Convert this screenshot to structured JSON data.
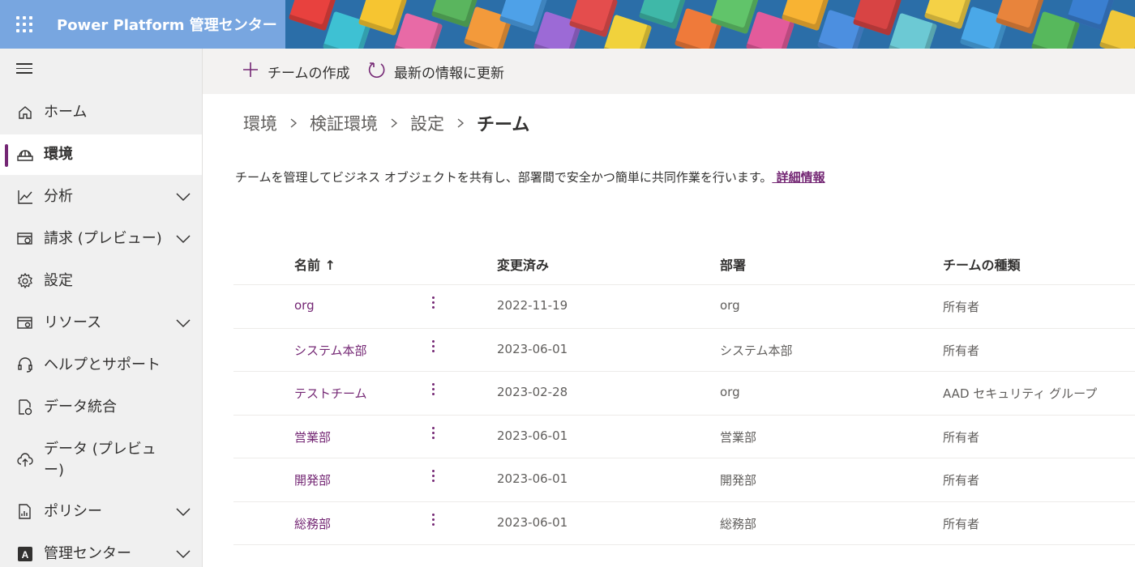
{
  "header": {
    "app_title": "Power Platform 管理センター",
    "accent": "#78a6e0"
  },
  "sidebar": {
    "items": [
      {
        "label": "ホーム",
        "icon": "home-icon"
      },
      {
        "label": "環境",
        "icon": "globe-icon",
        "selected": true
      },
      {
        "label": "分析",
        "icon": "chart-icon",
        "expandable": true
      },
      {
        "label": "請求 (プレビュー)",
        "icon": "billing-icon",
        "expandable": true
      },
      {
        "label": "設定",
        "icon": "gear-icon"
      },
      {
        "label": "リソース",
        "icon": "resources-icon",
        "expandable": true
      },
      {
        "label": "ヘルプとサポート",
        "icon": "headset-icon"
      },
      {
        "label": "データ統合",
        "icon": "data-integration-icon"
      },
      {
        "label": "データ (プレビュー)",
        "icon": "cloud-upload-icon"
      },
      {
        "label": "ポリシー",
        "icon": "policy-icon",
        "expandable": true
      },
      {
        "label": "管理センター",
        "icon": "admin-center-icon",
        "expandable": true
      }
    ]
  },
  "toolbar": {
    "create_team_label": "チームの作成",
    "refresh_label": "最新の情報に更新"
  },
  "breadcrumb": {
    "items": [
      "環境",
      "検証環境",
      "設定"
    ],
    "current": "チーム"
  },
  "description": {
    "text": "チームを管理してビジネス オブジェクトを共有し、部署間で安全かつ簡単に共同作業を行います。",
    "link": " 詳細情報"
  },
  "table": {
    "columns": {
      "name": "名前 ↑",
      "modified": "変更済み",
      "department": "部署",
      "team_type": "チームの種類"
    },
    "rows": [
      {
        "name": "org",
        "modified": "2022-11-19",
        "department": "org",
        "team_type": "所有者"
      },
      {
        "name": "システム本部",
        "modified": "2023-06-01",
        "department": "システム本部",
        "team_type": "所有者"
      },
      {
        "name": "テストチーム",
        "modified": "2023-02-28",
        "department": "org",
        "team_type": "AAD セキュリティ グループ"
      },
      {
        "name": "営業部",
        "modified": "2023-06-01",
        "department": "営業部",
        "team_type": "所有者"
      },
      {
        "name": "開発部",
        "modified": "2023-06-01",
        "department": "開発部",
        "team_type": "所有者"
      },
      {
        "name": "総務部",
        "modified": "2023-06-01",
        "department": "総務部",
        "team_type": "所有者"
      }
    ]
  },
  "colors": {
    "brand": "#742774",
    "sidebar_bg": "#f0f0f0",
    "toolbar_bg": "#f3f2f1"
  }
}
